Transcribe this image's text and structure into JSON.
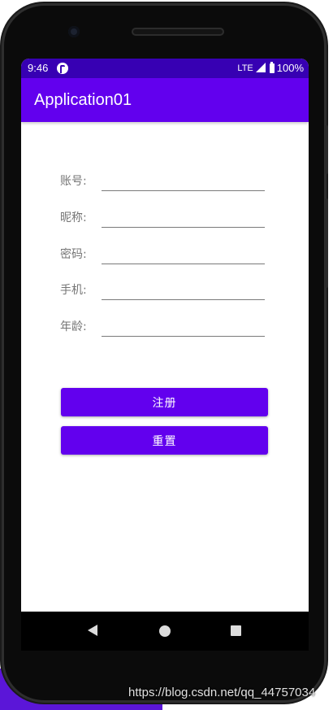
{
  "status_bar": {
    "time": "9:46",
    "network": "LTE",
    "battery": "100%",
    "icons": [
      "app-notification-icon",
      "signal-icon",
      "battery-icon"
    ]
  },
  "app_bar": {
    "title": "Application01"
  },
  "form": {
    "fields": [
      {
        "label": "账号:",
        "value": "",
        "placeholder": ""
      },
      {
        "label": "昵称:",
        "value": "",
        "placeholder": ""
      },
      {
        "label": "密码:",
        "value": "",
        "placeholder": ""
      },
      {
        "label": "手机:",
        "value": "",
        "placeholder": ""
      },
      {
        "label": "年龄:",
        "value": "",
        "placeholder": ""
      }
    ],
    "register_label": "注册",
    "reset_label": "重置"
  },
  "nav_bar": {
    "icons": [
      "back-icon",
      "home-icon",
      "recents-icon"
    ]
  },
  "watermark": "https://blog.csdn.net/qq_44757034",
  "colors": {
    "status_bar": "#3700b3",
    "primary": "#6200ee",
    "field_label": "#757575"
  }
}
